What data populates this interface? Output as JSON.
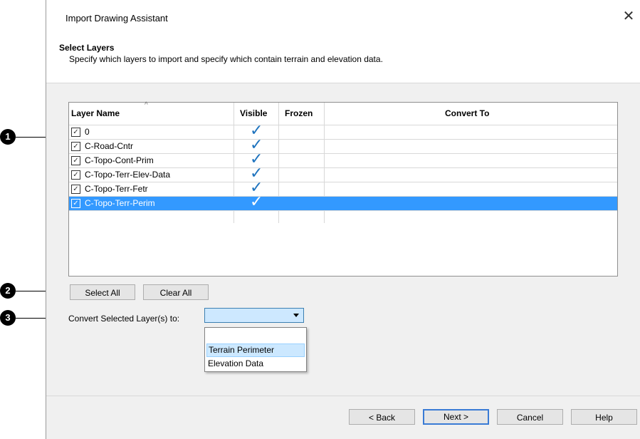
{
  "callouts": [
    "1",
    "2",
    "3"
  ],
  "dialog": {
    "title": "Import Drawing Assistant",
    "close_glyph": "✕"
  },
  "header": {
    "title": "Select Layers",
    "subtitle": "Specify which layers to import and specify which contain terrain and elevation data."
  },
  "table": {
    "columns": [
      "Layer Name",
      "Visible",
      "Frozen",
      "Convert To"
    ],
    "rows": [
      {
        "name": "0",
        "checked": true,
        "visible": true,
        "frozen": false,
        "convert_to": ""
      },
      {
        "name": "C-Road-Cntr",
        "checked": true,
        "visible": true,
        "frozen": false,
        "convert_to": ""
      },
      {
        "name": "C-Topo-Cont-Prim",
        "checked": true,
        "visible": true,
        "frozen": false,
        "convert_to": ""
      },
      {
        "name": "C-Topo-Terr-Elev-Data",
        "checked": true,
        "visible": true,
        "frozen": false,
        "convert_to": ""
      },
      {
        "name": "C-Topo-Terr-Fetr",
        "checked": true,
        "visible": true,
        "frozen": false,
        "convert_to": ""
      },
      {
        "name": "C-Topo-Terr-Perim",
        "checked": true,
        "visible": true,
        "frozen": false,
        "convert_to": "",
        "selected": true
      }
    ]
  },
  "buttons": {
    "select_all": "Select All",
    "clear_all": "Clear All",
    "back": "< Back",
    "next": "Next >",
    "cancel": "Cancel",
    "help": "Help"
  },
  "convert": {
    "label": "Convert Selected Layer(s) to:",
    "value": "",
    "options": [
      "",
      "Terrain Perimeter",
      "Elevation Data"
    ],
    "highlighted": "Terrain Perimeter"
  },
  "colors": {
    "selection": "#3399ff",
    "check_blue": "#1e73be",
    "dialog_bg": "#f0f0f0"
  }
}
